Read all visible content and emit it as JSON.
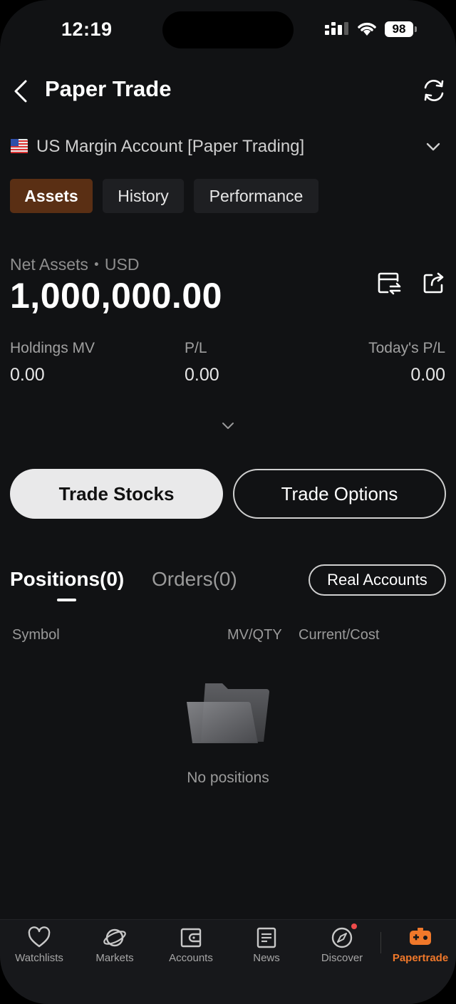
{
  "status_bar": {
    "time": "12:19",
    "battery": "98"
  },
  "header": {
    "title": "Paper Trade"
  },
  "account": {
    "name": "US Margin Account [Paper Trading]"
  },
  "tabs": [
    {
      "label": "Assets",
      "active": true
    },
    {
      "label": "History",
      "active": false
    },
    {
      "label": "Performance",
      "active": false
    }
  ],
  "assets": {
    "net_label": "Net Assets・USD",
    "net_value": "1,000,000.00",
    "metrics": [
      {
        "label": "Holdings MV",
        "value": "0.00"
      },
      {
        "label": "P/L",
        "value": "0.00"
      },
      {
        "label": "Today's P/L",
        "value": "0.00"
      }
    ]
  },
  "actions": {
    "trade_stocks": "Trade Stocks",
    "trade_options": "Trade Options"
  },
  "positions": {
    "tab_positions": "Positions(0)",
    "tab_orders": "Orders(0)",
    "real_accounts": "Real Accounts",
    "col_symbol": "Symbol",
    "col_mvqty": "MV/QTY",
    "col_current_cost": "Current/Cost",
    "empty": "No positions"
  },
  "nav": [
    {
      "label": "Watchlists",
      "icon": "heart-icon"
    },
    {
      "label": "Markets",
      "icon": "planet-icon"
    },
    {
      "label": "Accounts",
      "icon": "wallet-icon"
    },
    {
      "label": "News",
      "icon": "news-icon"
    },
    {
      "label": "Discover",
      "icon": "compass-icon"
    },
    {
      "label": "Papertrade",
      "icon": "gamepad-icon",
      "active": true
    }
  ],
  "colors": {
    "accent": "#f0782a",
    "active_tab_bg": "#5a2f14",
    "background": "#111214"
  }
}
